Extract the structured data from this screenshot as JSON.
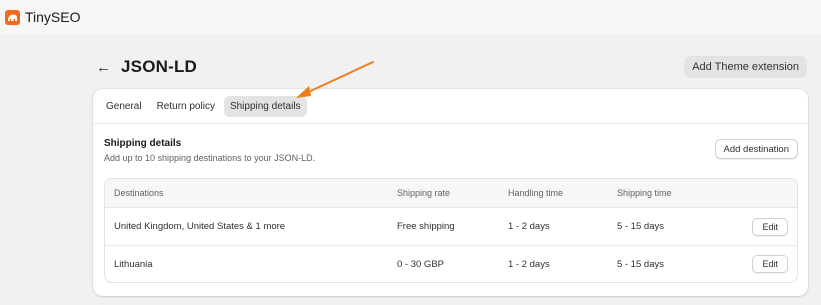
{
  "app": {
    "name": "TinySEO",
    "logo_icon": "tinyseo-logo-icon"
  },
  "header": {
    "back_icon": "arrow-left-icon",
    "title": "JSON-LD",
    "theme_button": "Add Theme extension"
  },
  "tabs": [
    {
      "label": "General",
      "active": false
    },
    {
      "label": "Return policy",
      "active": false
    },
    {
      "label": "Shipping details",
      "active": true
    }
  ],
  "section": {
    "title": "Shipping details",
    "subtitle": "Add up to 10 shipping destinations to your JSON-LD.",
    "add_button": "Add destination"
  },
  "table": {
    "headers": [
      "Destinations",
      "Shipping rate",
      "Handling time",
      "Shipping time"
    ],
    "rows": [
      {
        "destination": "United Kingdom, United States & 1 more",
        "rate": "Free shipping",
        "handling": "1 - 2 days",
        "shipping": "5 - 15 days",
        "action": "Edit"
      },
      {
        "destination": "Lithuania",
        "rate": "0 - 30 GBP",
        "handling": "1 - 2 days",
        "shipping": "5 - 15 days",
        "action": "Edit"
      }
    ]
  },
  "colors": {
    "brand": "#f26b1d",
    "annotation_arrow": "#f07d1a",
    "background": "#f1f1f1"
  }
}
